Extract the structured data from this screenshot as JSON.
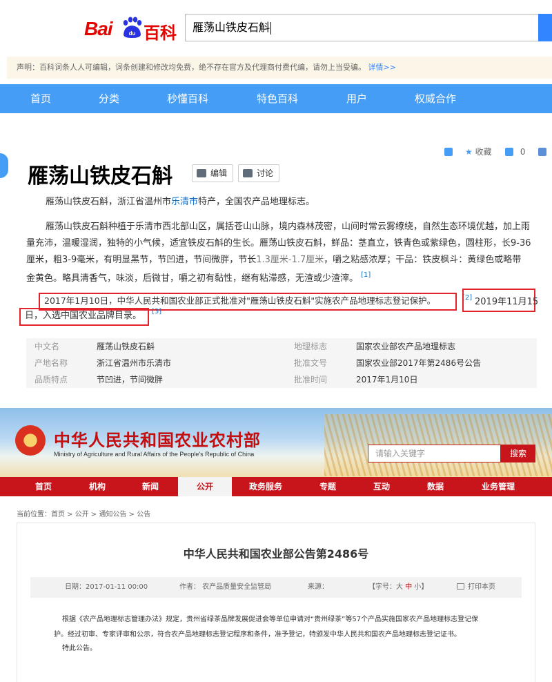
{
  "baidu": {
    "logo_bai": "Bai",
    "logo_du": "du",
    "logo_baike": "百科",
    "search_value": "雁荡山铁皮石斛",
    "notice_text": "声明：百科词条人人可编辑，词条创建和修改均免费，绝不存在官方及代理商付费代编，请勿上当受骗。",
    "notice_link": "详情>>",
    "nav": [
      "首页",
      "分类",
      "秒懂百科",
      "特色百科",
      "用户",
      "权威合作"
    ],
    "tools": {
      "collect": "收藏",
      "like_count": "0"
    },
    "title": "雁荡山铁皮石斛",
    "edit_button": "编辑",
    "discuss_button": "讨论",
    "intro_pre": "雁荡山铁皮石斛，浙江省温州市",
    "intro_link": "乐清市",
    "intro_post": "特产，全国农产品地理标志。",
    "para2_line1": "雁荡山铁皮石斛种植于乐清市西北部山区，属括苍山山脉，境内森林茂密，山间时常云雾缭绕，自然生态环境优越，加上雨",
    "para2_line2": "量充沛，温暖湿润，独特的小气候，适宜铁皮石斛的生长。雁荡山铁皮石斛，鲜品：茎直立，铁青色或紫绿色，圆柱形，长9-36",
    "para2_line3a": "厘米，粗3-9毫米，有明显黑节，节凹进，节间微胖，节长",
    "para2_line3b": "1.3厘米-1.7厘米",
    "para2_line3c": "，嚼之粘感浓厚；干品：铁皮枫斗：黄绿色或略带",
    "para2_line4": "金黄色。略具清香气，味淡，后微甘，嚼之初有黏性，继有粘滞感，无渣或少渣滓。",
    "ref1": "[1]",
    "highlight1": "2017年1月10日，中华人民共和国农业部正式批准对\"雁荡山铁皮石斛\"实施农产品地理标志登记保护。",
    "ref2": "[2]",
    "highlight2": "2019年11月15",
    "highlight3": "日，入选中国农业品牌目录。",
    "ref3": "[3]",
    "info": [
      {
        "k1": "中文名",
        "v1": "雁荡山铁皮石斛",
        "k2": "地理标志",
        "v2": "国家农业部农产品地理标志"
      },
      {
        "k1": "产地名称",
        "v1": "浙江省温州市乐清市",
        "k2": "批准文号",
        "v2": "国家农业部2017年第2486号公告"
      },
      {
        "k1": "品质特点",
        "v1": "节凹进，节间微胖",
        "k2": "批准时间",
        "v2": "2017年1月10日"
      }
    ]
  },
  "moa": {
    "title": "中华人民共和国农业农村部",
    "subtitle": "Ministry of Agriculture and Rural Affairs of the People's Republic of China",
    "search_placeholder": "请输入关键字",
    "search_button": "搜索",
    "nav": [
      "首页",
      "机构",
      "新闻",
      "公开",
      "政务服务",
      "专题",
      "互动",
      "数据",
      "业务管理"
    ],
    "active_nav": "公开",
    "breadcrumb": "当前位置：首页 > 公开 > 通知公告 > 公告",
    "article_title": "中华人民共和国农业部公告第2486号",
    "meta": {
      "date": "日期：2017-01-11 00:00",
      "author": "作者： 农产品质量安全监管局",
      "source": "来源：",
      "font_label": "【字号：",
      "font_big": "大",
      "font_mid": "中",
      "font_small": "小",
      "font_end": "】",
      "print": "打印本页"
    },
    "body_line1": "根据《农产品地理标志管理办法》规定，贵州省绿茶品牌发展促进会等单位申请对“贵州绿茶”等57个产品实施国家农产品地理标志登记保",
    "body_line2": "护。经过初审、专家评审和公示，符合农产品地理标志登记程序和条件，准予登记，特颁发中华人民共和国农产品地理标志登记证书。",
    "body_line3": "特此公告。"
  }
}
